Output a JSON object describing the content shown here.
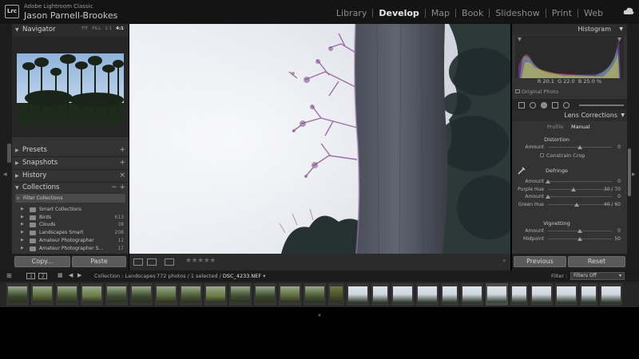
{
  "app": {
    "logo": "Lrc",
    "name": "Adobe Lightroom Classic",
    "user": "Jason Parnell-Brookes"
  },
  "modules": [
    {
      "label": "Library",
      "active": false
    },
    {
      "label": "Develop",
      "active": true
    },
    {
      "label": "Map",
      "active": false
    },
    {
      "label": "Book",
      "active": false
    },
    {
      "label": "Slideshow",
      "active": false
    },
    {
      "label": "Print",
      "active": false
    },
    {
      "label": "Web",
      "active": false
    }
  ],
  "left_panel": {
    "navigator": {
      "title": "Navigator",
      "zoom_options": [
        "FIT",
        "FILL",
        "1:1",
        "4:1"
      ],
      "zoom_active": "4:1"
    },
    "sections": [
      {
        "title": "Presets",
        "control": "+"
      },
      {
        "title": "Snapshots",
        "control": "+"
      },
      {
        "title": "History",
        "control": "×"
      },
      {
        "title": "Collections",
        "control": "− +"
      }
    ],
    "filter_placeholder": "Filter Collections",
    "collections": [
      {
        "name": "Smart Collections",
        "count": ""
      },
      {
        "name": "Birds",
        "count": "613"
      },
      {
        "name": "Clouds",
        "count": "38"
      },
      {
        "name": "Landscapes Smart",
        "count": "208"
      },
      {
        "name": "Amateur Photographer",
        "count": "11"
      },
      {
        "name": "Amateur Photographer S...",
        "count": "17"
      }
    ],
    "copy_label": "Copy...",
    "paste_label": "Paste"
  },
  "right_panel": {
    "histogram_title": "Histogram",
    "readout": {
      "r": "20.1",
      "g": "22.0",
      "b": "25.0",
      "unit": "%"
    },
    "original_photo": "Original Photo",
    "lens_title": "Lens Corrections",
    "tabs": [
      "Profile",
      "Manual"
    ],
    "tab_active": "Manual",
    "distortion": {
      "title": "Distortion",
      "amount_label": "Amount",
      "amount_value": "0",
      "constrain_label": "Constrain Crop"
    },
    "defringe": {
      "title": "Defringe",
      "rows": [
        {
          "label": "Amount",
          "value": "0",
          "level": 0.0
        },
        {
          "label": "Purple Hue",
          "value": "30 / 70",
          "level": 0.4
        },
        {
          "label": "Amount",
          "value": "0",
          "level": 0.0
        },
        {
          "label": "Green Hue",
          "value": "40 / 60",
          "level": 0.45
        }
      ]
    },
    "vignetting": {
      "title": "Vignetting",
      "rows": [
        {
          "label": "Amount",
          "value": "0",
          "level": 0.5
        },
        {
          "label": "Midpoint",
          "value": "50",
          "level": 0.5
        }
      ]
    },
    "previous_label": "Previous",
    "reset_label": "Reset"
  },
  "toolbar": {
    "rating_stars": "★★★★★"
  },
  "filmstrip": {
    "page_1": "1",
    "page_2": "2",
    "source_prefix": "Collection : Landscapes",
    "count_text": "772 photos / 1 selected /",
    "filename": "DSC_4233.NEF",
    "filename_suffix": "▾",
    "filter_label": "Filter :",
    "filter_value": "Filters Off"
  },
  "colors": {
    "accent_text": "#e8e8e8",
    "panel_bg": "#333333",
    "sky": "#dfe2ea",
    "fringe": "#8d5a98"
  }
}
